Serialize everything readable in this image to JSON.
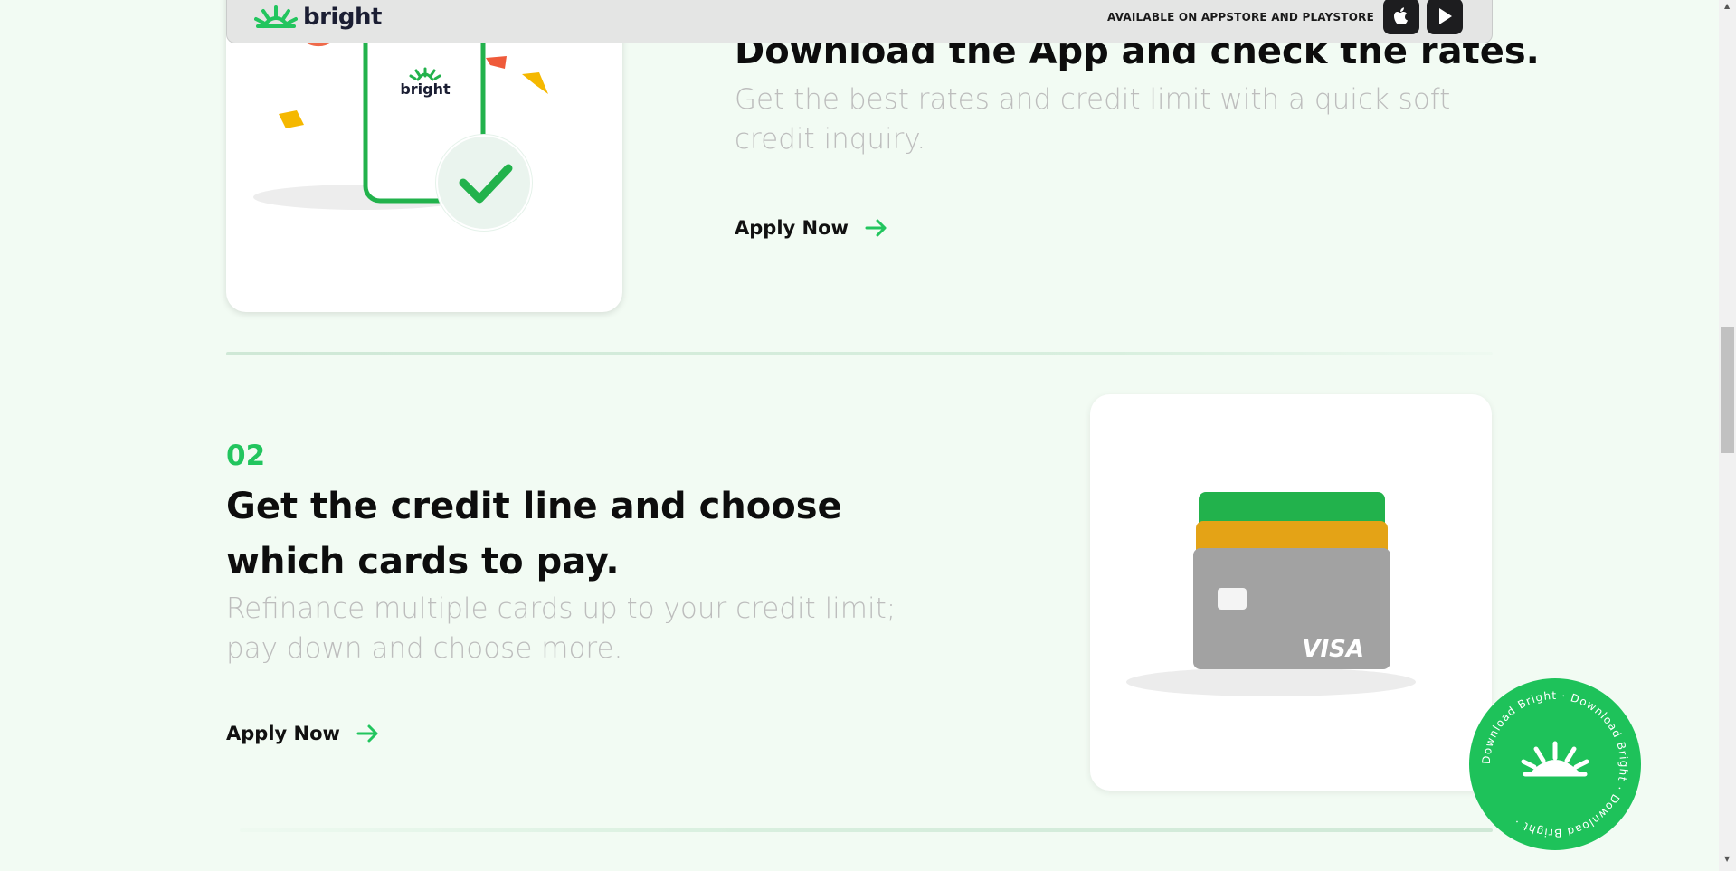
{
  "navbar": {
    "logo_text": "bright",
    "store_text": "AVAILABLE ON APPSTORE AND PLAYSTORE",
    "apple_icon": "apple-icon",
    "play_icon": "play-store-icon"
  },
  "step1": {
    "phone_logo_text": "bright",
    "title": "Download the App and check the rates.",
    "description": "Get the best rates and credit limit with a quick soft credit inquiry.",
    "cta": "Apply Now"
  },
  "step2": {
    "number": "02",
    "title": "Get the credit line and choose which cards to pay.",
    "description": "Refinance multiple cards up to your credit limit; pay down and choose more.",
    "cta": "Apply Now",
    "card_brand": "VISA"
  },
  "badge": {
    "ring_text": "Download Bright · Download Bright · Download Bright · "
  },
  "colors": {
    "accent_green": "#22c55e",
    "background": "#f2fbf3",
    "card_yellow": "#e4a316",
    "card_gray": "#9f9f9f"
  }
}
